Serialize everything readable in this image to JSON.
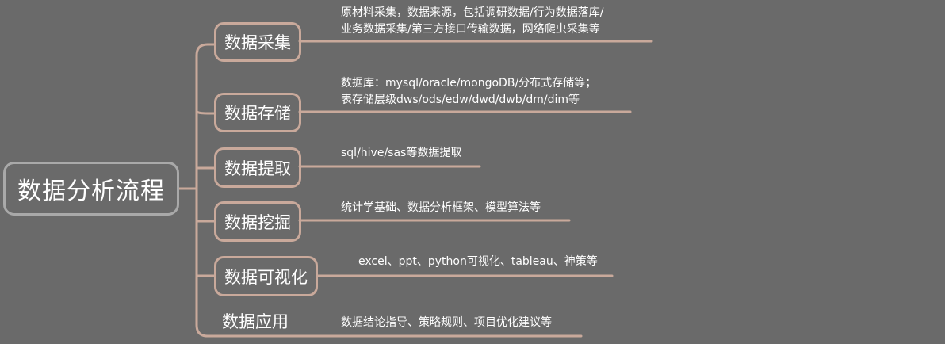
{
  "root": {
    "label": "数据分析流程"
  },
  "branches": [
    {
      "label": "数据采集",
      "desc": [
        "原材料采集，数据来源，包括调研数据/行为数据落库/",
        "业务数据采集/第三方接口传输数据，网络爬虫采集等"
      ]
    },
    {
      "label": "数据存储",
      "desc": [
        "数据库：mysql/oracle/mongoDB/分布式存储等；",
        "表存储层级dws/ods/edw/dwd/dwb/dm/dim等"
      ]
    },
    {
      "label": "数据提取",
      "desc": [
        "sql/hive/sas等数据提取"
      ]
    },
    {
      "label": "数据挖掘",
      "desc": [
        "统计学基础、数据分析框架、模型算法等"
      ]
    },
    {
      "label": "数据可视化",
      "desc": [
        "excel、ppt、python可视化、tableau、神策等"
      ]
    },
    {
      "label": "数据应用",
      "desc": [
        "数据结论指导、策略规则、项目优化建议等"
      ]
    }
  ],
  "colors": {
    "background": "#6a6a6a",
    "root_border": "#a9a9a9",
    "branch_border": "#c9a99b",
    "text": "#ffffff"
  }
}
